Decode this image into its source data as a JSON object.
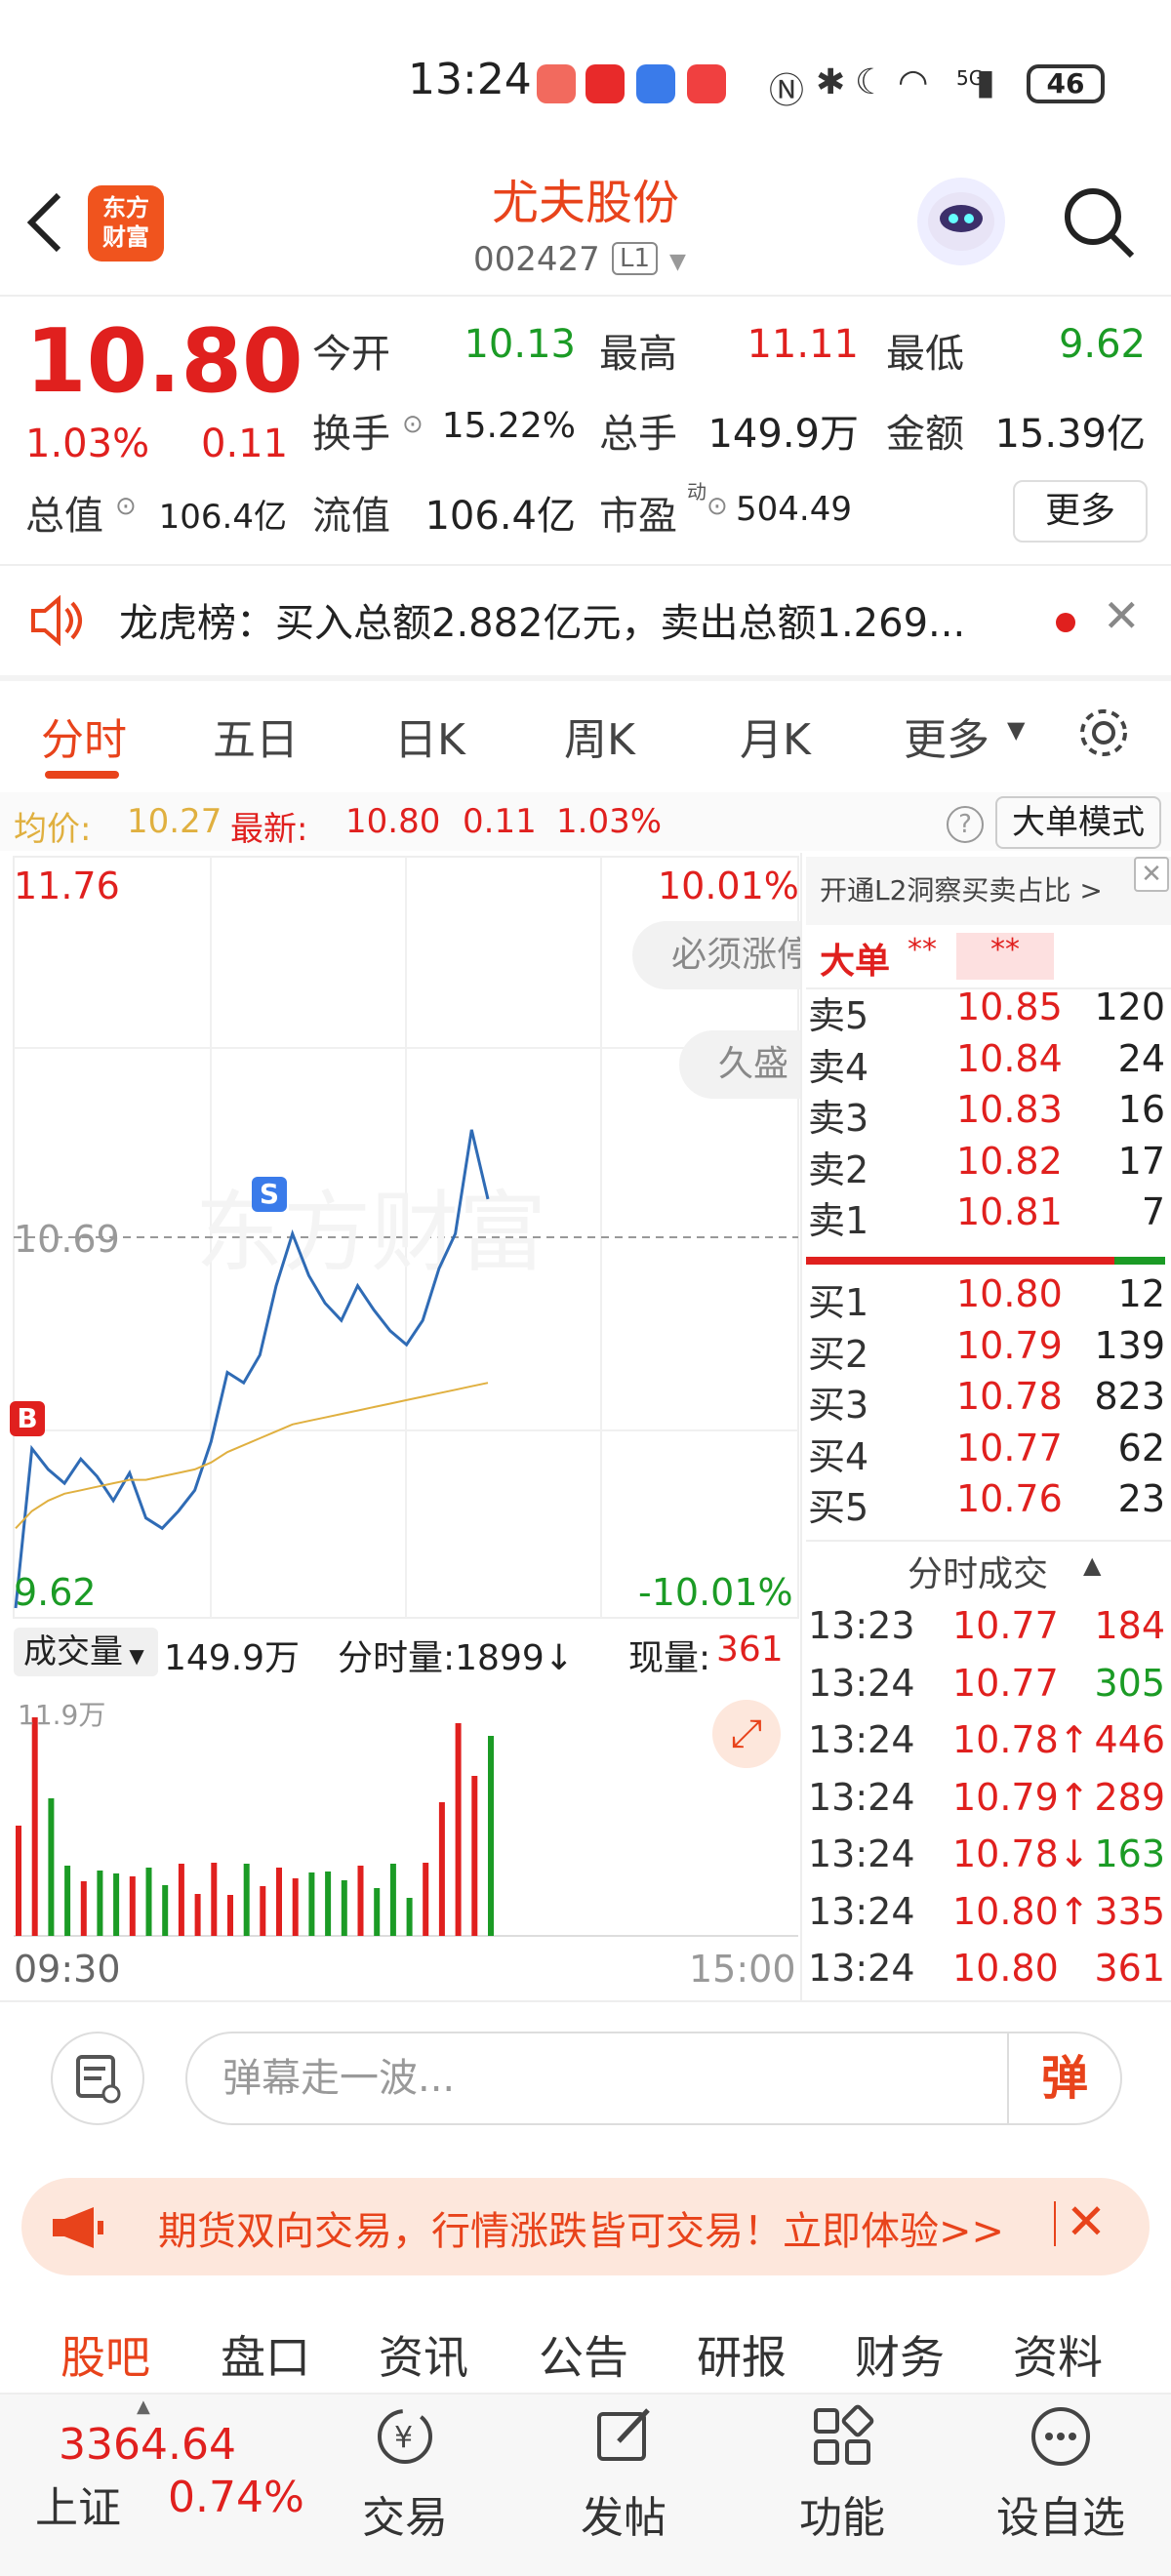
{
  "status_bar": {
    "time": "13:24",
    "battery": "46",
    "signal": "5G"
  },
  "header": {
    "stock_name": "尤夫股份",
    "stock_code": "002427",
    "level": "L1",
    "logo_text_1": "东方",
    "logo_text_2": "财富"
  },
  "quote": {
    "price": "10.80",
    "pct": "1.03%",
    "change": "0.11",
    "open_label": "今开",
    "open": "10.13",
    "high_label": "最高",
    "high": "11.11",
    "low_label": "最低",
    "low": "9.62",
    "turnover_label": "换手",
    "turnover": "15.22%",
    "volume_label": "总手",
    "volume": "149.9万",
    "amount_label": "金额",
    "amount": "15.39亿",
    "mcap_label": "总值",
    "mcap": "106.4亿",
    "float_label": "流值",
    "float": "106.4亿",
    "pe_label": "市盈",
    "pe_sup": "动",
    "pe": "504.49",
    "more": "更多"
  },
  "dragon_tiger": {
    "text": "龙虎榜：买入总额2.882亿元，卖出总额1.269..."
  },
  "tabs": [
    "分时",
    "五日",
    "日K",
    "周K",
    "月K",
    "更多"
  ],
  "avg_line": {
    "avg_label": "均价:",
    "avg": "10.27",
    "latest_label": "最新:",
    "latest": "10.80",
    "chg": "0.11",
    "pct": "1.03%",
    "help": "?",
    "mode": "大单模式"
  },
  "chart": {
    "y_high": "11.76",
    "y_low": "9.62",
    "y_mid": "10.69",
    "pct_high": "10.01%",
    "pct_low": "-10.01%",
    "watermark": "东方财富",
    "bubble_1": "必须涨停",
    "bubble_2": "久盛",
    "marker_s": "S",
    "marker_b": "B",
    "time_start": "09:30",
    "time_end": "15:00",
    "vol_label": "成交量",
    "vol_total": "149.9万",
    "vol_tick_label": "分时量:1899↓",
    "vol_now_label": "现量:",
    "vol_now": "361",
    "vol_max": "11.9万"
  },
  "chart_data": {
    "type": "line",
    "xlabel": "",
    "ylabel": "",
    "ylim": [
      9.62,
      11.76
    ],
    "x": [
      "09:30",
      "09:35",
      "09:40",
      "09:45",
      "09:50",
      "09:55",
      "10:00",
      "10:05",
      "10:10",
      "10:15",
      "10:20",
      "10:25",
      "10:30",
      "10:35",
      "10:40",
      "10:45",
      "10:50",
      "10:55",
      "11:00",
      "11:05",
      "11:10",
      "11:15",
      "11:20",
      "11:25",
      "11:30",
      "13:05",
      "13:10",
      "13:15",
      "13:20",
      "13:24"
    ],
    "series": [
      {
        "values": [
          9.62,
          10.08,
          10.02,
          9.98,
          10.05,
          10.0,
          9.93,
          10.01,
          9.88,
          9.85,
          9.9,
          9.96,
          10.1,
          10.3,
          10.27,
          10.35,
          10.55,
          10.7,
          10.58,
          10.5,
          10.45,
          10.55,
          10.48,
          10.42,
          10.38,
          10.45,
          10.6,
          10.7,
          11.0,
          10.8
        ]
      },
      {
        "values": [
          9.85,
          9.9,
          9.93,
          9.95,
          9.96,
          9.97,
          9.98,
          9.99,
          9.99,
          10.0,
          10.01,
          10.02,
          10.04,
          10.07,
          10.09,
          10.11,
          10.13,
          10.15,
          10.16,
          10.17,
          10.18,
          10.19,
          10.2,
          10.21,
          10.22,
          10.23,
          10.24,
          10.25,
          10.26,
          10.27
        ]
      }
    ]
  },
  "order_book": {
    "banner": "开通L2洞察买卖占比 >",
    "big_label": "大单",
    "big_v1": "**",
    "big_v2": "**",
    "asks": [
      {
        "label": "卖5",
        "price": "10.85",
        "vol": "120"
      },
      {
        "label": "卖4",
        "price": "10.84",
        "vol": "24"
      },
      {
        "label": "卖3",
        "price": "10.83",
        "vol": "16"
      },
      {
        "label": "卖2",
        "price": "10.82",
        "vol": "17"
      },
      {
        "label": "卖1",
        "price": "10.81",
        "vol": "7"
      }
    ],
    "bids": [
      {
        "label": "买1",
        "price": "10.80",
        "vol": "12"
      },
      {
        "label": "买2",
        "price": "10.79",
        "vol": "139"
      },
      {
        "label": "买3",
        "price": "10.78",
        "vol": "823"
      },
      {
        "label": "买4",
        "price": "10.77",
        "vol": "62"
      },
      {
        "label": "买5",
        "price": "10.76",
        "vol": "23"
      }
    ],
    "ticks_title": "分时成交",
    "ticks": [
      {
        "time": "13:23",
        "price": "10.77",
        "vol": "184",
        "color": "#e0201e"
      },
      {
        "time": "13:24",
        "price": "10.77",
        "vol": "305",
        "color": "#1b9b25"
      },
      {
        "time": "13:24",
        "price": "10.78↑",
        "vol": "446",
        "color": "#e0201e"
      },
      {
        "time": "13:24",
        "price": "10.79↑",
        "vol": "289",
        "color": "#e0201e"
      },
      {
        "time": "13:24",
        "price": "10.78↓",
        "vol": "163",
        "color": "#1b9b25"
      },
      {
        "time": "13:24",
        "price": "10.80↑",
        "vol": "335",
        "color": "#e0201e"
      },
      {
        "time": "13:24",
        "price": "10.80",
        "vol": "361",
        "color": "#e0201e"
      }
    ]
  },
  "danmu": {
    "placeholder": "弹幕走一波...",
    "button": "弹"
  },
  "ad": {
    "text": "期货双向交易，行情涨跌皆可交易！立即体验>>"
  },
  "bottom_tabs": [
    "股吧",
    "盘口",
    "资讯",
    "公告",
    "研报",
    "财务",
    "资料"
  ],
  "nav": {
    "index_value": "3364.64",
    "index_name": "上证",
    "index_pct": "0.74%",
    "trade": "交易",
    "post": "发帖",
    "functions": "功能",
    "watchlist": "设自选"
  },
  "colors": {
    "up": "#e0201e",
    "down": "#1b9b25",
    "accent": "#e8431b",
    "price_line": "#2f6bb5",
    "avg_line": "#e0b040"
  }
}
